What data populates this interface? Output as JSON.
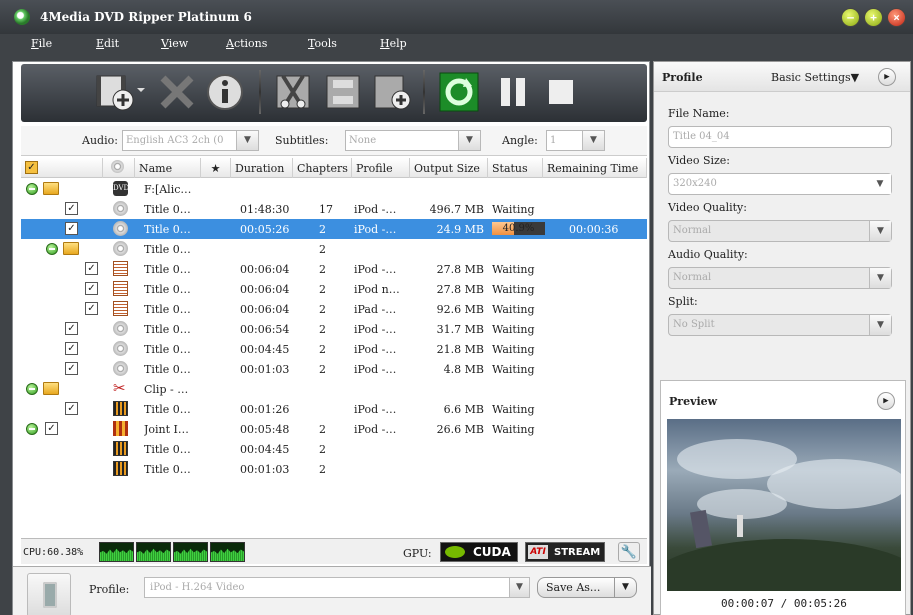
{
  "window": {
    "title": "4Media DVD Ripper Platinum 6"
  },
  "menu": [
    "File",
    "Edit",
    "View",
    "Actions",
    "Tools",
    "Help"
  ],
  "options": {
    "audio_label": "Audio:",
    "audio_value": "English AC3 2ch (0",
    "subtitles_label": "Subtitles:",
    "subtitles_value": "None",
    "angle_label": "Angle:",
    "angle_value": "1"
  },
  "columns": [
    "Name",
    "Duration",
    "Chapters",
    "Profile",
    "Output Size",
    "Status",
    "Remaining Time"
  ],
  "rows": [
    {
      "name": "F:[Alic…",
      "indent": 0,
      "icon": "dvd",
      "group": true
    },
    {
      "name": "Title 0…",
      "duration": "01:48:30",
      "chapters": "17",
      "profile": "iPod -…",
      "size": "496.7 MB",
      "status": "Waiting",
      "checked": true,
      "indent": 1,
      "icon": "disc"
    },
    {
      "name": "Title 0…",
      "duration": "00:05:26",
      "chapters": "2",
      "profile": "iPod -…",
      "size": "24.9 MB",
      "progress": "40.9%",
      "progress_value": 0.409,
      "remaining": "00:00:36",
      "checked": true,
      "indent": 1,
      "icon": "disc",
      "selected": true
    },
    {
      "name": "Title 0…",
      "chapters": "2",
      "indent": 1,
      "icon": "disc",
      "group": true
    },
    {
      "name": "Title 0…",
      "duration": "00:06:04",
      "chapters": "2",
      "profile": "iPod -…",
      "size": "27.8 MB",
      "status": "Waiting",
      "checked": true,
      "indent": 2,
      "icon": "doc"
    },
    {
      "name": "Title 0…",
      "duration": "00:06:04",
      "chapters": "2",
      "profile": "iPod n…",
      "size": "27.8 MB",
      "status": "Waiting",
      "checked": true,
      "indent": 2,
      "icon": "doc"
    },
    {
      "name": "Title 0…",
      "duration": "00:06:04",
      "chapters": "2",
      "profile": "iPad -…",
      "size": "92.6 MB",
      "status": "Waiting",
      "checked": true,
      "indent": 2,
      "icon": "doc"
    },
    {
      "name": "Title 0…",
      "duration": "00:06:54",
      "chapters": "2",
      "profile": "iPod -…",
      "size": "31.7 MB",
      "status": "Waiting",
      "checked": true,
      "indent": 1,
      "icon": "disc"
    },
    {
      "name": "Title 0…",
      "duration": "00:04:45",
      "chapters": "2",
      "profile": "iPod -…",
      "size": "21.8 MB",
      "status": "Waiting",
      "checked": true,
      "indent": 1,
      "icon": "disc"
    },
    {
      "name": "Title 0…",
      "duration": "00:01:03",
      "chapters": "2",
      "profile": "iPod -…",
      "size": "4.8 MB",
      "status": "Waiting",
      "checked": true,
      "indent": 1,
      "icon": "disc"
    },
    {
      "name": "Clip - …",
      "indent": 0,
      "icon": "scis",
      "group": true
    },
    {
      "name": "Title 0…",
      "duration": "00:01:26",
      "profile": "iPod -…",
      "size": "6.6 MB",
      "status": "Waiting",
      "checked": true,
      "indent": 1,
      "icon": "film"
    },
    {
      "name": "Joint I…",
      "duration": "00:05:48",
      "chapters": "2",
      "profile": "iPod -…",
      "size": "26.6 MB",
      "status": "Waiting",
      "checked": true,
      "indent": 0,
      "icon": "joint",
      "group": true,
      "group_check": true
    },
    {
      "name": "Title 0…",
      "duration": "00:04:45",
      "chapters": "2",
      "indent": 1,
      "icon": "film"
    },
    {
      "name": "Title 0…",
      "duration": "00:01:03",
      "chapters": "2",
      "indent": 1,
      "icon": "film"
    }
  ],
  "status": {
    "cpu_label": "CPU:60.38%",
    "gpu_label": "GPU:",
    "cuda": "CUDA",
    "stream": "STREAM",
    "ati": "ATI"
  },
  "bottom": {
    "profile_label": "Profile:",
    "profile_value": "iPod - H.264 Video",
    "save_as": "Save As..."
  },
  "right": {
    "header": "Profile",
    "basic_settings": "Basic Settings",
    "file_name_label": "File Name:",
    "file_name_value": "Title 04_04",
    "video_size_label": "Video Size:",
    "video_size_value": "320x240",
    "video_quality_label": "Video Quality:",
    "video_quality_value": "Normal",
    "audio_quality_label": "Audio Quality:",
    "audio_quality_value": "Normal",
    "split_label": "Split:",
    "split_value": "No Split",
    "preview_header": "Preview",
    "preview_time": "00:00:07 / 00:05:26"
  }
}
